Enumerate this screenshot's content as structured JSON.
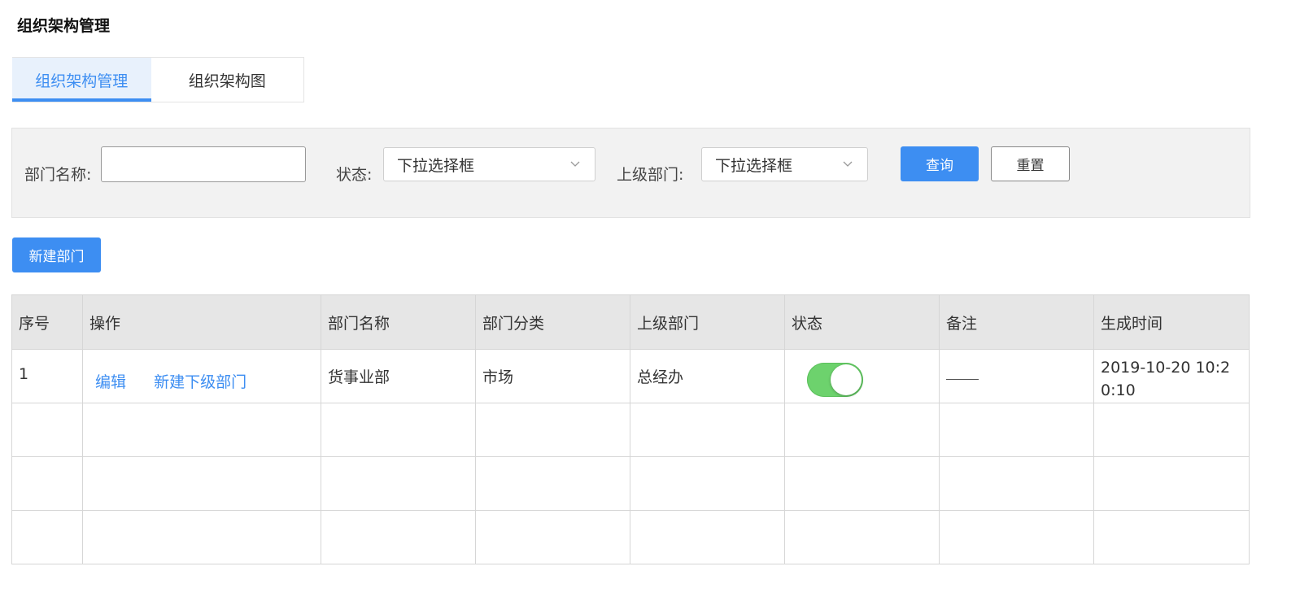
{
  "page": {
    "title": "组织架构管理"
  },
  "tabs": [
    {
      "label": "组织架构管理",
      "active": true
    },
    {
      "label": "组织架构图",
      "active": false
    }
  ],
  "filters": {
    "dept_name_label": "部门名称:",
    "dept_name_value": "",
    "status_label": "状态:",
    "status_value": "下拉选择框",
    "parent_label": "上级部门:",
    "parent_value": "下拉选择框",
    "query_button": "查询",
    "reset_button": "重置"
  },
  "actions": {
    "new_dept_button": "新建部门"
  },
  "table": {
    "columns": [
      "序号",
      "操作",
      "部门名称",
      "部门分类",
      "上级部门",
      "状态",
      "备注",
      "生成时间"
    ],
    "rows": [
      {
        "index": "1",
        "edit_link": "编辑",
        "new_sub_link": "新建下级部门",
        "dept_name": "货事业部",
        "category": "市场",
        "parent": "总经办",
        "status_on": true,
        "note": "——",
        "created_at": "2019-10-20 10:20:10"
      }
    ]
  },
  "colors": {
    "accent": "#3d8ef2",
    "toggle_on": "#6dd26d",
    "header_bg": "#e6e6e6",
    "filter_bg": "#f2f2f2"
  }
}
